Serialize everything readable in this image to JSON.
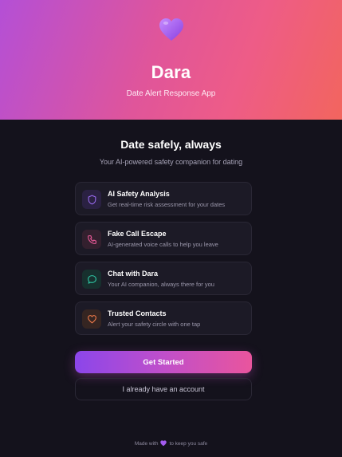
{
  "hero": {
    "icon": "purple-heart-icon",
    "title": "Dara",
    "subtitle": "Date Alert Response App"
  },
  "main": {
    "headline": "Date safely, always",
    "tagline": "Your AI-powered safety companion for dating"
  },
  "features": [
    {
      "icon": "shield-icon",
      "accent": "#9b6cf2",
      "title": "AI Safety Analysis",
      "desc": "Get real-time risk assessment for your dates"
    },
    {
      "icon": "phone-icon",
      "accent": "#ec5a9a",
      "title": "Fake Call Escape",
      "desc": "AI-generated voice calls to help you leave"
    },
    {
      "icon": "chat-bubble-icon",
      "accent": "#2fc7a5",
      "title": "Chat with Dara",
      "desc": "Your AI companion, always there for you"
    },
    {
      "icon": "heart-outline-icon",
      "accent": "#f07a4a",
      "title": "Trusted Contacts",
      "desc": "Alert your safety circle with one tap"
    }
  ],
  "actions": {
    "primary_label": "Get Started",
    "secondary_label": "I already have an account"
  },
  "footer": {
    "prefix": "Made with",
    "icon": "purple-heart-icon",
    "suffix": "to keep you safe"
  }
}
